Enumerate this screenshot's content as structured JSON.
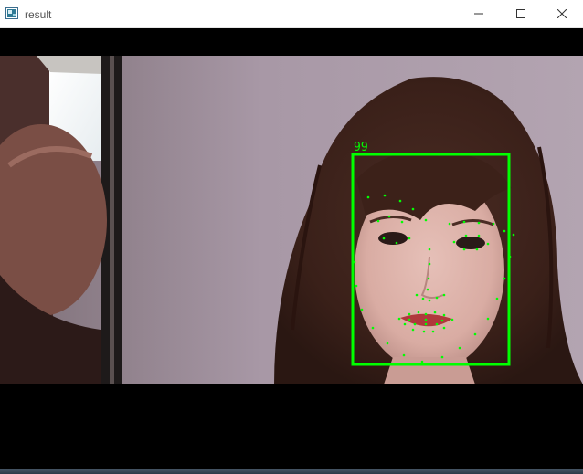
{
  "window": {
    "title": "result",
    "icon": "opencv-window-icon",
    "controls": {
      "minimize_icon": "minimize-icon",
      "maximize_icon": "maximize-icon",
      "close_icon": "close-icon"
    }
  },
  "detection": {
    "confidence_label": "99",
    "box_color": "#00ff00",
    "landmark_color": "#00ff00"
  }
}
